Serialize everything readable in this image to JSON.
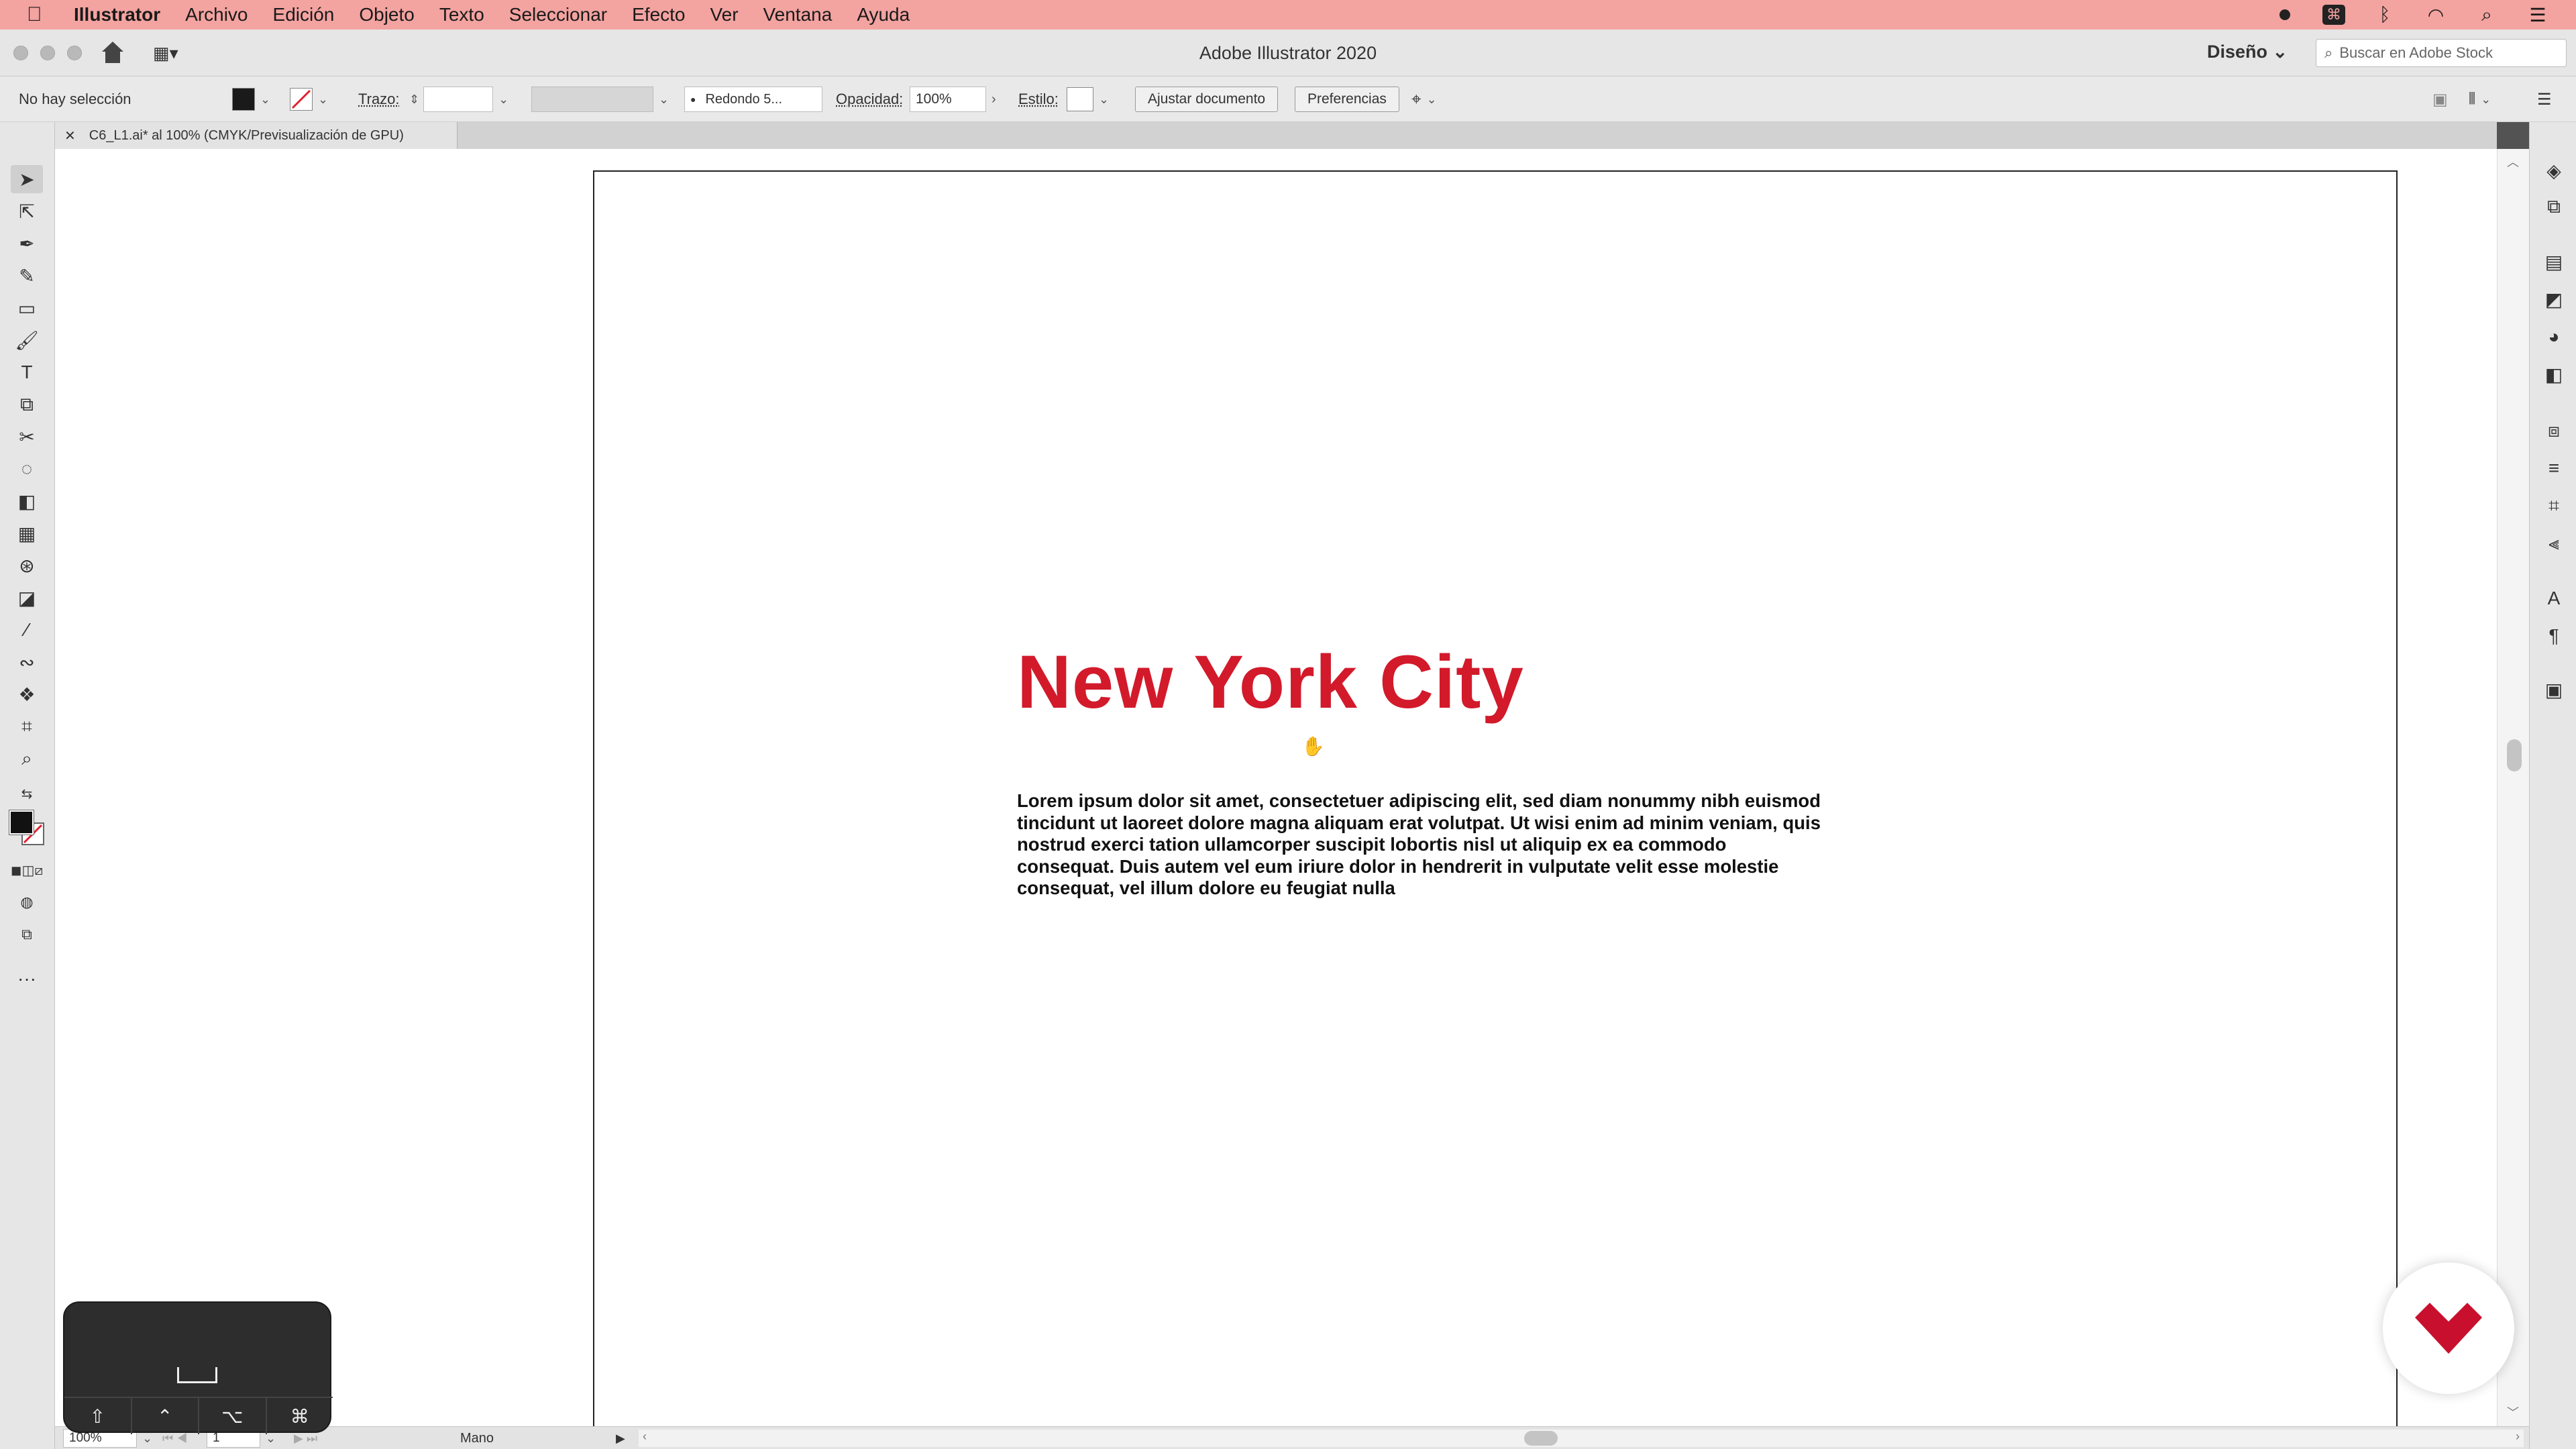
{
  "menubar": {
    "app": "Illustrator",
    "items": [
      "Archivo",
      "Edición",
      "Objeto",
      "Texto",
      "Seleccionar",
      "Efecto",
      "Ver",
      "Ventana",
      "Ayuda"
    ]
  },
  "titlebar": {
    "title": "Adobe Illustrator 2020",
    "workspace": "Diseño",
    "search_placeholder": "Buscar en Adobe Stock"
  },
  "control": {
    "selection": "No hay selección",
    "stroke_label": "Trazo:",
    "brush": "Redondo 5...",
    "opacity_label": "Opacidad:",
    "opacity_value": "100%",
    "style_label": "Estilo:",
    "adjust_doc": "Ajustar documento",
    "preferences": "Preferencias"
  },
  "document": {
    "tab": "C6_L1.ai* al 100% (CMYK/Previsualización de GPU)",
    "headline": "New York City",
    "body": "Lorem ipsum dolor sit amet, consectetuer adipiscing elit, sed diam nonummy nibh euismod tincidunt ut laoreet dolore magna aliquam erat volutpat. Ut wisi enim ad minim veniam, quis nostrud exerci tation ullamcorper suscipit lobortis nisl ut aliquip ex ea commodo consequat. Duis autem vel eum iriure dolor in hendrerit in vulputate velit esse molestie consequat, vel illum dolore eu feugiat nulla"
  },
  "status": {
    "zoom": "100%",
    "artboard": "1",
    "tool": "Mano"
  },
  "keys": [
    "⇧",
    "⌃",
    "⌥",
    "⌘"
  ],
  "colors": {
    "menubar_bg": "#f3a3a0",
    "headline": "#d21a2b",
    "brand": "#c8102e"
  }
}
